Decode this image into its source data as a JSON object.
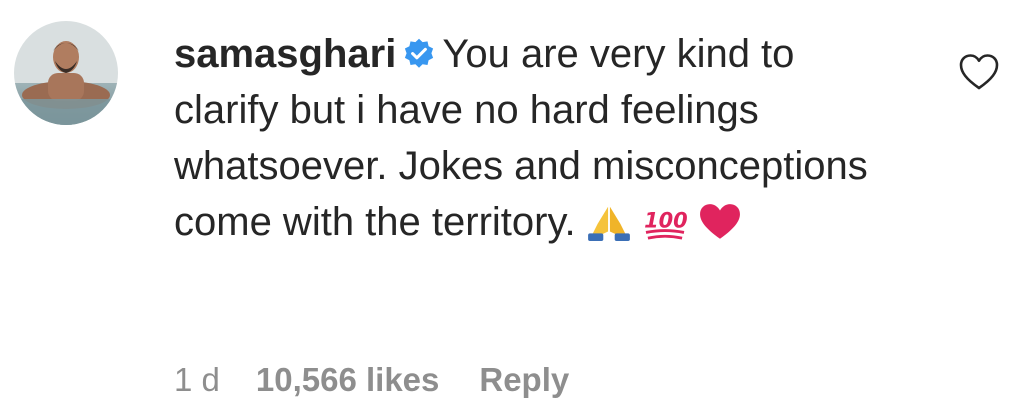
{
  "comment": {
    "avatar_alt": "samasghari profile picture",
    "username": "samasghari",
    "verified": true,
    "text": "You are very kind to clarify but i have no hard feelings whatsoever. Jokes and misconceptions come with the territory.",
    "emojis": [
      "folded-hands",
      "hundred-points",
      "red-heart"
    ],
    "time": "1 d",
    "likes": "10,566 likes",
    "reply_label": "Reply",
    "like_icon": "heart-outline-icon",
    "colors": {
      "text": "#262626",
      "meta": "#8e8e8e",
      "verified_badge": "#3897f0",
      "heart_emoji": "#e0245e"
    }
  }
}
